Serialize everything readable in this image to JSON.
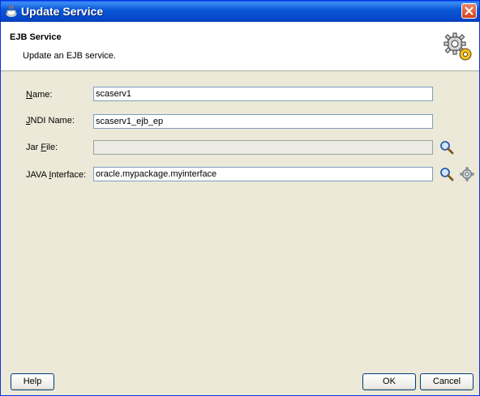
{
  "window": {
    "title": "Update Service",
    "close_icon": "close-icon"
  },
  "header": {
    "title": "EJB Service",
    "description": "Update an EJB service.",
    "icon": "gears-icon"
  },
  "form": {
    "name": {
      "label_mnemonic": "N",
      "label_rest": "ame:",
      "value": "scaserv1"
    },
    "jndi_name": {
      "label_mnemonic": "J",
      "label_rest": "NDI Name:",
      "value": "scaserv1_ejb_ep"
    },
    "jar_file": {
      "label_prefix": "Jar ",
      "label_mnemonic": "F",
      "label_rest": "ile:",
      "value": ""
    },
    "java_interface": {
      "label_prefix": "JAVA ",
      "label_mnemonic": "I",
      "label_rest": "nterface:",
      "value": "oracle.mypackage.myinterface"
    }
  },
  "buttons": {
    "help": "Help",
    "ok": "OK",
    "cancel": "Cancel"
  },
  "colors": {
    "title_bar": "#0b5ad8",
    "dialog_bg": "#ece9d8",
    "header_bg": "#ffffff"
  }
}
